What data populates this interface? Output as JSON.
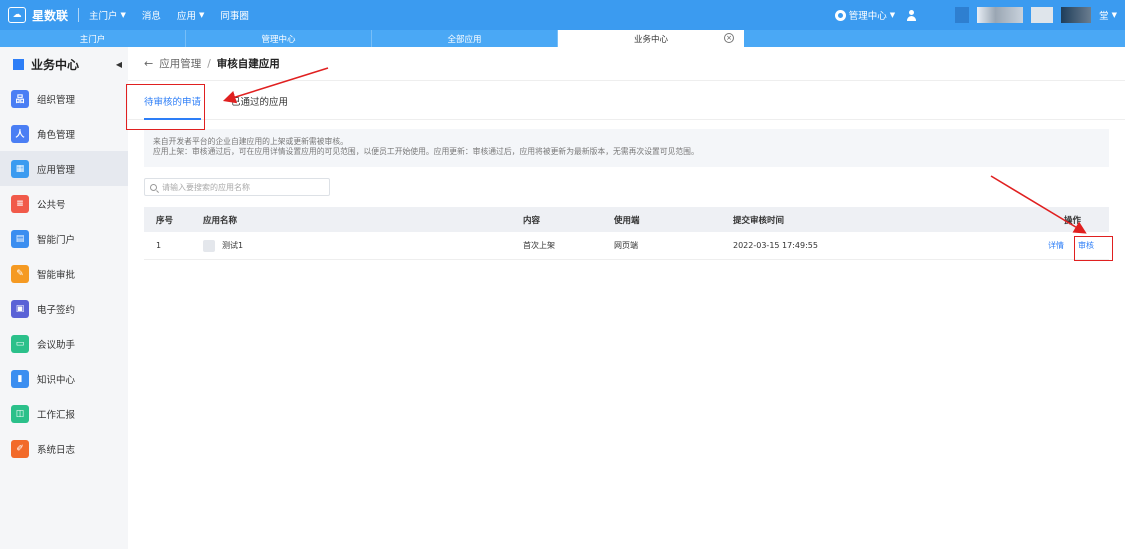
{
  "topbar": {
    "brand": "星数联",
    "nav": [
      {
        "label": "主门户",
        "caret": true
      },
      {
        "label": "消息",
        "caret": false
      },
      {
        "label": "应用",
        "caret": true
      },
      {
        "label": "同事圈",
        "caret": false
      }
    ],
    "admin_center": "管理中心",
    "user_name_tail": "堂"
  },
  "page_tabs": [
    {
      "label": "主门户",
      "active": false
    },
    {
      "label": "管理中心",
      "active": false
    },
    {
      "label": "全部应用",
      "active": false
    },
    {
      "label": "业务中心",
      "active": true,
      "close": "×"
    }
  ],
  "sidebar": {
    "title": "业务中心",
    "items": [
      {
        "label": "组织管理",
        "icon": "org-icon",
        "color": "#4a7ef4",
        "active": false
      },
      {
        "label": "角色管理",
        "icon": "role-icon",
        "color": "#4a7ef4",
        "active": false
      },
      {
        "label": "应用管理",
        "icon": "app-icon",
        "color": "#3b9bf0",
        "active": true
      },
      {
        "label": "公共号",
        "icon": "public-account-icon",
        "color": "#f15a4a",
        "active": false
      },
      {
        "label": "智能门户",
        "icon": "portal-icon",
        "color": "#3b8ef0",
        "active": false
      },
      {
        "label": "智能审批",
        "icon": "approval-icon",
        "color": "#f59a23",
        "active": false
      },
      {
        "label": "电子签约",
        "icon": "esign-icon",
        "color": "#5a62d6",
        "active": false
      },
      {
        "label": "会议助手",
        "icon": "meeting-icon",
        "color": "#2bc08a",
        "active": false
      },
      {
        "label": "知识中心",
        "icon": "knowledge-icon",
        "color": "#3b8ef0",
        "active": false
      },
      {
        "label": "工作汇报",
        "icon": "report-icon",
        "color": "#2bc08a",
        "active": false
      },
      {
        "label": "系统日志",
        "icon": "log-icon",
        "color": "#f26a2a",
        "active": false
      }
    ]
  },
  "breadcrumb": {
    "parent": "应用管理",
    "separator": "/",
    "current": "审核自建应用"
  },
  "tabs": [
    {
      "label": "待审核的申请",
      "active": true
    },
    {
      "label": "已通过的应用",
      "active": false
    }
  ],
  "notice": {
    "line1": "来自开发者平台的企业自建应用的上架或更新需被审核。",
    "line2": "应用上架：审核通过后，可在应用详情设置应用的可见范围，以便员工开始使用。应用更新：审核通过后，应用将被更新为最新版本，无需再次设置可见范围。"
  },
  "search": {
    "placeholder": "请输入要搜索的应用名称"
  },
  "table": {
    "headers": [
      "序号",
      "应用名称",
      "内容",
      "使用端",
      "提交审核时间",
      "操作"
    ],
    "rows": [
      {
        "index": "1",
        "name": "测试1",
        "content": "首次上架",
        "client": "网页端",
        "submitted": "2022-03-15 17:49:55",
        "actions": [
          "详情",
          "审核"
        ]
      }
    ]
  },
  "colors": {
    "primary": "#2d7ef7",
    "topbar": "#3b9bf0",
    "annotation": "#e02020"
  }
}
